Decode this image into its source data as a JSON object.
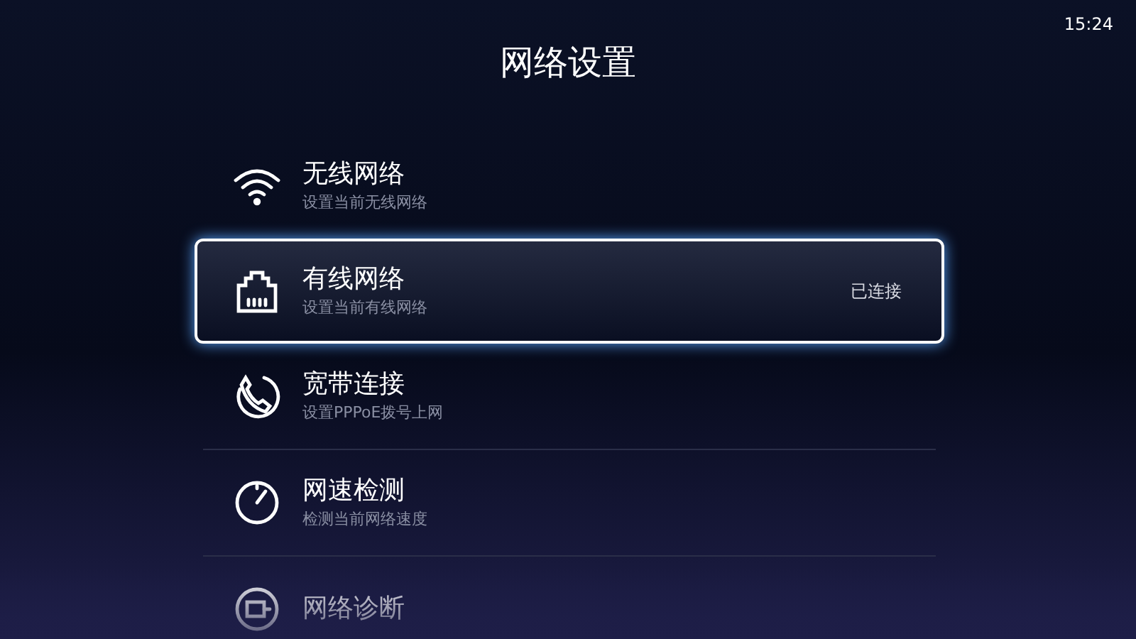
{
  "clock": "15:24",
  "title": "网络设置",
  "items": [
    {
      "kind": "wifi",
      "label": "无线网络",
      "subtitle": "设置当前无线网络",
      "selected": false
    },
    {
      "kind": "ethernet",
      "label": "有线网络",
      "subtitle": "设置当前有线网络",
      "status": "已连接",
      "selected": true
    },
    {
      "kind": "phone",
      "label": "宽带连接",
      "subtitle": "设置PPPoE拨号上网",
      "selected": false
    },
    {
      "kind": "speed",
      "label": "网速检测",
      "subtitle": "检测当前网络速度",
      "selected": false
    },
    {
      "kind": "diagnose",
      "label": "网络诊断",
      "selected": false
    }
  ]
}
